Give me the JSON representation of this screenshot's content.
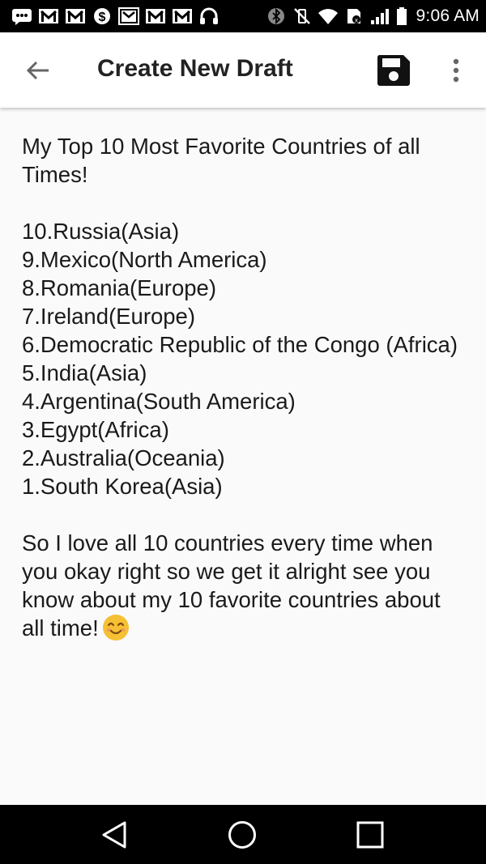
{
  "status_bar": {
    "time": "9:06 AM",
    "notification_icons": [
      "messages-icon",
      "gmail-icon",
      "gmail-icon",
      "cash-icon",
      "gmail-icon",
      "gmail-icon",
      "gmail-icon",
      "headphones-icon"
    ],
    "system_icons": [
      "bluetooth-icon",
      "vibrate-off-icon",
      "wifi-icon",
      "sim-icon",
      "signal-icon",
      "battery-icon"
    ]
  },
  "app_bar": {
    "title": "Create New Draft",
    "back_icon": "arrow-left-icon",
    "save_icon": "floppy-disk-icon",
    "overflow_icon": "more-vert-icon"
  },
  "draft": {
    "heading": "My Top 10 Most Favorite Countries of all Times!",
    "list": [
      "10.Russia(Asia)",
      "9.Mexico(North America)",
      "8.Romania(Europe)",
      "7.Ireland(Europe)",
      "6.Democratic Republic of the Congo (Africa)",
      "5.India(Asia)",
      "4.Argentina(South America)",
      "3.Egypt(Africa)",
      "2.Australia(Oceania)",
      "1.South Korea(Asia)"
    ],
    "closing": "So I love all 10 countries every time when you okay right so we get it alright see you know about my 10 favorite countries about all time!",
    "emoji_icon": "smiling-face-icon"
  },
  "nav_bar": {
    "buttons": [
      "nav-back-icon",
      "nav-home-icon",
      "nav-recents-icon"
    ]
  },
  "colors": {
    "status_bar_bg": "#000000",
    "app_bar_bg": "#ffffff",
    "content_bg": "#fafafa",
    "text": "#1a1a1a",
    "emoji": "#f5c034"
  }
}
